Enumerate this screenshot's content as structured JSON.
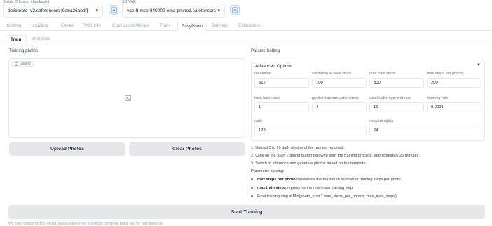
{
  "header": {
    "checkpoint_label": "Stable Diffusion checkpoint",
    "checkpoint_value": "deliberate_v2.safetensors [9aba26abdf]",
    "vae_label": "SD VAE",
    "vae_value": "vae-ft-mse-840000-ema-pruned.safetensors"
  },
  "main_tabs": [
    {
      "label": "txt2img"
    },
    {
      "label": "img2img"
    },
    {
      "label": "Extras"
    },
    {
      "label": "PNG Info"
    },
    {
      "label": "Checkpoint Merger"
    },
    {
      "label": "Train"
    },
    {
      "label": "EasyPhoto"
    },
    {
      "label": "Settings"
    },
    {
      "label": "Extensions"
    }
  ],
  "sub_tabs": [
    {
      "label": "Train"
    },
    {
      "label": "Inference"
    }
  ],
  "training_photos": {
    "label": "Training photos",
    "gallery_label": "Gallery"
  },
  "buttons": {
    "upload": "Upload Photos",
    "clear": "Clear Photos",
    "start": "Start Training"
  },
  "params": {
    "section_label": "Params Setting",
    "advanced_label": "Advanced Options",
    "fields": [
      {
        "label": "resolution",
        "value": "512"
      },
      {
        "label": "validation & save steps",
        "value": "100"
      },
      {
        "label": "max train steps",
        "value": "800"
      },
      {
        "label": "max steps per photos",
        "value": "200"
      },
      {
        "label": "train batch size",
        "value": "1"
      },
      {
        "label": "gradient accumulationsteps",
        "value": "4"
      },
      {
        "label": "dataloader num workers",
        "value": "16"
      },
      {
        "label": "learning rate",
        "value": "0.0001"
      },
      {
        "label": "rank",
        "value": "128"
      },
      {
        "label": "network alpha",
        "value": "64"
      }
    ]
  },
  "notes": {
    "lines": [
      "1. Upload 5 to 10 daily photos of the training required.",
      "2. Click on the Start Training button below to start the training process, approximately 25 minutes.",
      "3. Switch to Inference and generate photos based on the template.",
      "Parameter parsing:"
    ],
    "bullets": [
      {
        "bold": "max steps per photo",
        "text": " represents the maximum number of training steps per photo."
      },
      {
        "bold": "max train steps",
        "text": " represents the maximum training step."
      },
      {
        "bold": "",
        "text": "Final training step = Min(photo_num * max_steps_per_photos, max_train_steps)"
      }
    ]
  },
  "footer": {
    "faded_text": "We need to train first to predict, please wait for the training to complete, thank you for your patience."
  },
  "colors": {
    "button_bg": "#e5e7eb",
    "border": "#e5e7eb",
    "muted_text": "#9ca3af"
  }
}
